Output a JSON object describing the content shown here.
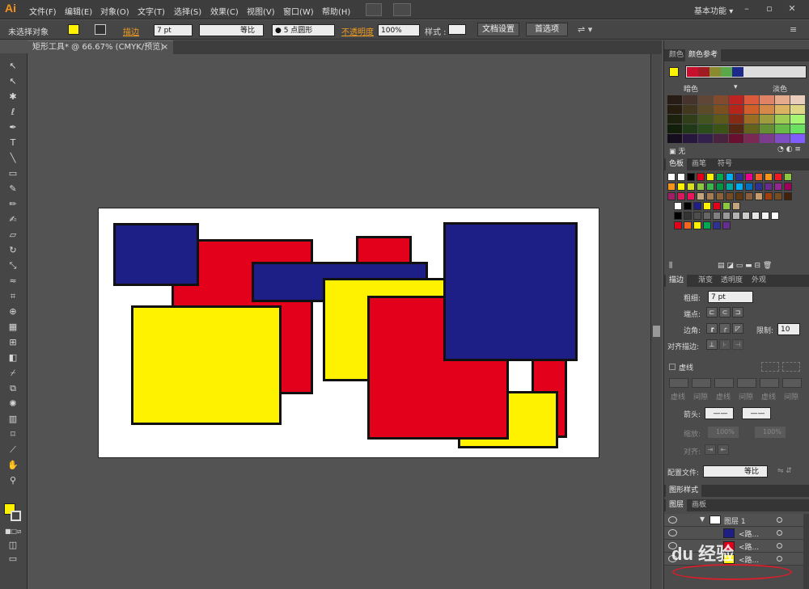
{
  "app": {
    "logo": "Ai",
    "workspace": "基本功能",
    "workspace_caret": "▾"
  },
  "menu": [
    "文件(F)",
    "编辑(E)",
    "对象(O)",
    "文字(T)",
    "选择(S)",
    "效果(C)",
    "视图(V)",
    "窗口(W)",
    "帮助(H)"
  ],
  "control": {
    "no_selection": "未选择对象",
    "stroke_label": "描边",
    "stroke_weight": "7 pt",
    "stroke_profile": "等比",
    "brush": "● 5 点圆形",
    "opacity_label": "不透明度",
    "opacity": "100%",
    "style_label": "样式 :",
    "doc_setup": "文档设置",
    "prefs": "首选项"
  },
  "document": {
    "tab_title": "矩形工具* @ 66.67% (CMYK/预览)",
    "close": "×"
  },
  "colors": {
    "fill": "#fff200",
    "red": "#e3001b",
    "blue": "#1d1f86",
    "yellow": "#fff200"
  },
  "color_guide": {
    "tab_color": "颜色",
    "tab_guide": "颜色参考",
    "dark_label": "暗色",
    "light_label": "淡色",
    "none_label": "无",
    "harmony": [
      "#c8102e",
      "#a01c22",
      "#8a8b30",
      "#5aa84a",
      "#1d2a8a",
      "#2a2a6a"
    ]
  },
  "swatches": {
    "tab_swatch": "色板",
    "tab_brush": "画笔",
    "tab_symbol": "符号"
  },
  "stroke_panel": {
    "tab_stroke": "描边",
    "tab_gradient": "渐变",
    "tab_transparency": "透明度",
    "tab_appearance": "外观",
    "weight_label": "粗细:",
    "weight": "7 pt",
    "cap_label": "端点:",
    "corner_label": "边角:",
    "limit_label": "限制:",
    "limit": "10",
    "align_label": "对齐描边:",
    "dashed_label": "虚线",
    "dash_labels": [
      "虚线",
      "间隙",
      "虚线",
      "间隙",
      "虚线",
      "间隙"
    ],
    "arrow_label": "箭头:",
    "scale_label": "缩放:",
    "scale1": "100%",
    "scale2": "100%",
    "align2_label": "对齐:",
    "profile_label": "配置文件:",
    "profile": "等比"
  },
  "graphic_styles": {
    "tab": "图形样式"
  },
  "layers": {
    "tab_layers": "图层",
    "tab_artboards": "画板",
    "layer_name": "图层 1",
    "sublayers": [
      "<路...",
      "<路...",
      "<路..."
    ]
  },
  "watermark": "du 经验"
}
